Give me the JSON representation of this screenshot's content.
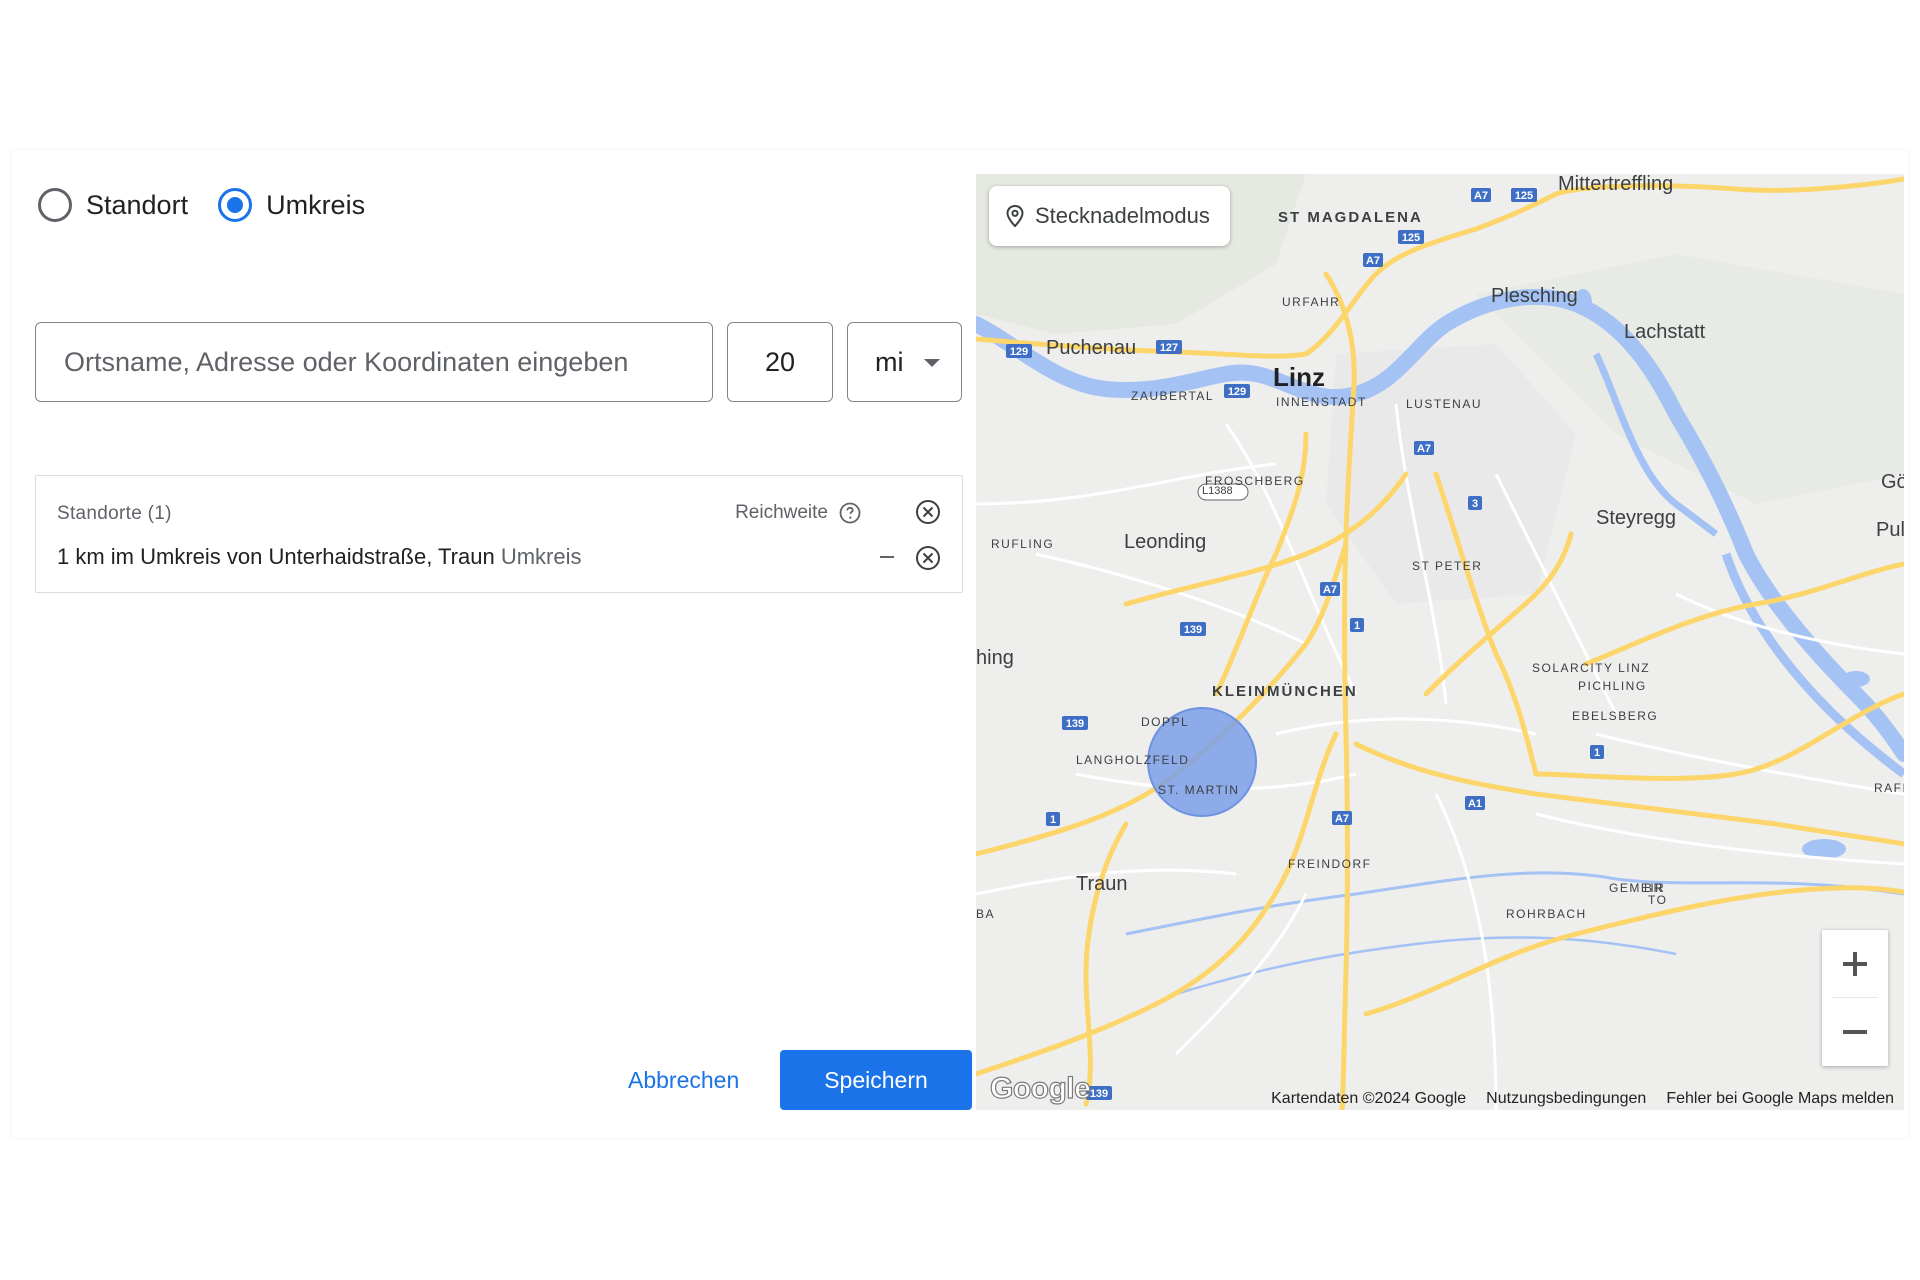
{
  "mode": {
    "options": [
      {
        "label": "Standort",
        "checked": false
      },
      {
        "label": "Umkreis",
        "checked": true
      }
    ]
  },
  "search": {
    "placeholder": "Ortsname, Adresse oder Koordinaten eingeben",
    "value": ""
  },
  "radius": {
    "value": "20",
    "unit": "mi"
  },
  "locations": {
    "header": "Standorte (1)",
    "reach_label": "Reichweite",
    "items": [
      {
        "text": "1 km im Umkreis von Unterhaidstraße, Traun",
        "suffix": "Umkreis",
        "reach": "–"
      }
    ]
  },
  "actions": {
    "cancel": "Abbrechen",
    "save": "Speichern"
  },
  "map": {
    "pin_mode_label": "Stecknadelmodus",
    "attribution": [
      "Kartendaten ©2024 Google",
      "Nutzungsbedingungen",
      "Fehler bei Google Maps melden"
    ],
    "logo": "Google",
    "zoom_in": "+",
    "zoom_out": "−",
    "labels": {
      "mittertreffling": "Mittertreffling",
      "st_magdalena": "ST MAGDALENA",
      "urfahr": "URFAHR",
      "plesching": "Plesching",
      "lachstatt": "Lachstatt",
      "puchenau": "Puchenau",
      "linz": "Linz",
      "zaubertal": "ZAUBERTAL",
      "innenstadt": "INNENSTADT",
      "lustenau": "LUSTENAU",
      "froschberg": "FROSCHBERG",
      "got": "Göt",
      "steyregg": "Steyregg",
      "pul": "Pul",
      "rufling": "RUFLING",
      "leonding": "Leonding",
      "st_peter": "ST PETER",
      "hing": "hing",
      "kleinmuenchen": "KLEINMÜNCHEN",
      "solarcity": "SOLARCITY LINZ",
      "pichling": "PICHLING",
      "doppl": "DOPPL",
      "ebelsberg": "EBELSBERG",
      "langholzfeld": "LANGHOLZFELD",
      "st_martin": "ST. MARTIN",
      "raf": "RAFI",
      "freindorf": "FREINDORF",
      "traun": "Traun",
      "gemeir": "GEMEIR",
      "rohrbach": "ROHRBACH",
      "br": "BR",
      "to": "TO",
      "ba": "BA",
      "l1388": "L1388"
    },
    "shields": [
      "A7",
      "125",
      "129",
      "127",
      "1",
      "3",
      "139",
      "A1"
    ],
    "colors": {
      "water": "#a4c2f4",
      "highway": "#fcd56b",
      "radius_fill": "#7b9fe8",
      "bg": "#eeeeec"
    }
  }
}
